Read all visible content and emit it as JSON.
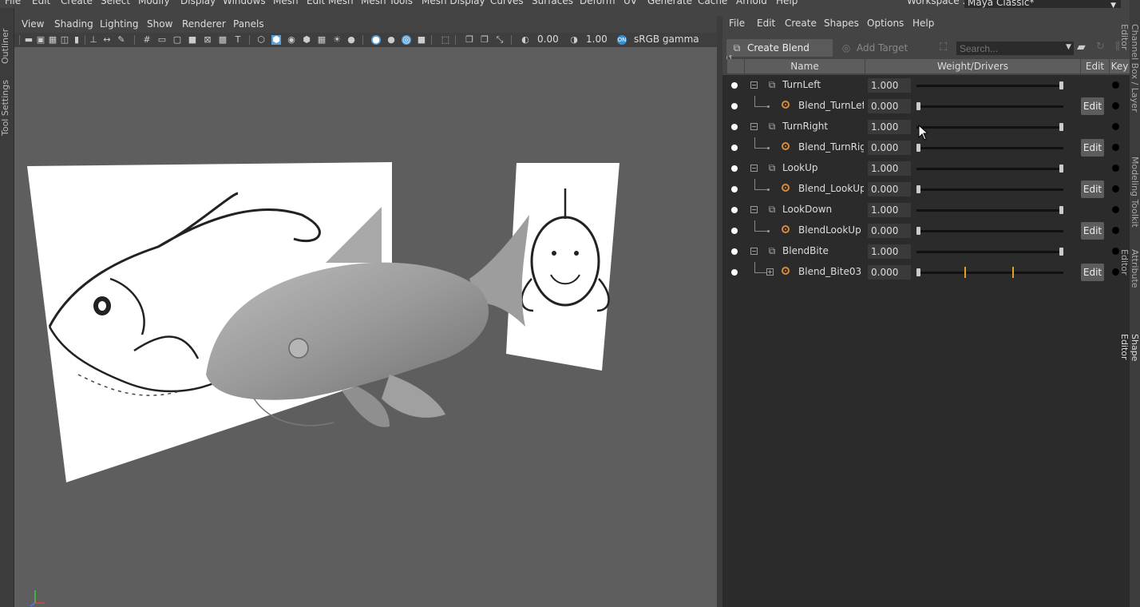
{
  "main_menu": {
    "items": [
      "File",
      "Edit",
      "Create",
      "Select",
      "Modify",
      "Display",
      "Windows",
      "Mesh",
      "Edit Mesh",
      "Mesh Tools",
      "Mesh Display",
      "Curves",
      "Surfaces",
      "Deform",
      "UV",
      "Generate",
      "Cache",
      "Arnold",
      "Help"
    ],
    "workspace_label": "Workspace :",
    "workspace_value": "Maya Classic*"
  },
  "left_tabs": [
    "Outliner",
    "Tool Settings"
  ],
  "viewport": {
    "menu": [
      "View",
      "Shading",
      "Lighting",
      "Show",
      "Renderer",
      "Panels"
    ],
    "exposure": "0.00",
    "gamma": "1.00",
    "color_space": "sRGB gamma"
  },
  "shape_editor": {
    "menu": [
      "File",
      "Edit",
      "Create",
      "Shapes",
      "Options",
      "Help"
    ],
    "create_blend_shape": "Create Blend Shape",
    "add_target": "Add Target",
    "search_placeholder": "Search...",
    "columns": {
      "name": "Name",
      "weight": "Weight/Drivers",
      "edit": "Edit",
      "key": "Key"
    },
    "edit_label": "Edit",
    "rows": [
      {
        "name": "TurnLeft",
        "weight": "1.000",
        "level": 0,
        "slider": 1.0
      },
      {
        "name": "Blend_TurnLeft",
        "weight": "0.000",
        "level": 1,
        "slider": 0.0
      },
      {
        "name": "TurnRight",
        "weight": "1.000",
        "level": 0,
        "slider": 1.0
      },
      {
        "name": "Blend_TurnRigh",
        "weight": "0.000",
        "level": 1,
        "slider": 0.0
      },
      {
        "name": "LookUp",
        "weight": "1.000",
        "level": 0,
        "slider": 1.0
      },
      {
        "name": "Blend_LookUp",
        "weight": "0.000",
        "level": 1,
        "slider": 0.0
      },
      {
        "name": "LookDown",
        "weight": "1.000",
        "level": 0,
        "slider": 1.0
      },
      {
        "name": "BlendLookUp",
        "weight": "0.000",
        "level": 1,
        "slider": 0.0
      },
      {
        "name": "BlendBite",
        "weight": "1.000",
        "level": 0,
        "slider": 1.0
      },
      {
        "name": "Blend_Bite03",
        "weight": "0.000",
        "level": 1,
        "slider": 0.0
      }
    ]
  },
  "right_tabs": [
    "Channel Box / Layer Editor",
    "Modeling Toolkit",
    "Attribute Editor",
    "Shape Editor"
  ],
  "colors": {
    "accent_orange": "#d98a3d",
    "keyframe": "#e0a020",
    "viewport_bg": "#5e5e5e"
  }
}
